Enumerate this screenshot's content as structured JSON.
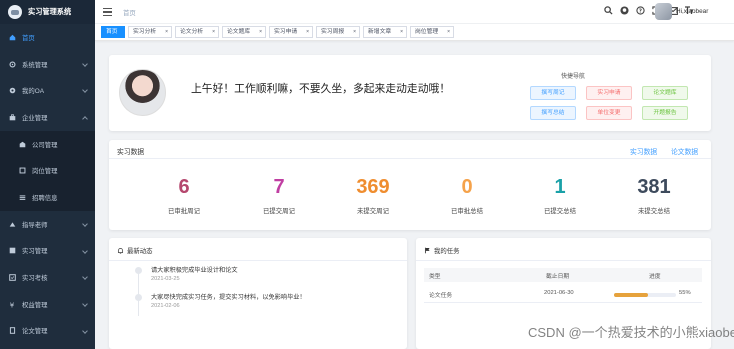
{
  "app": {
    "title": "实习管理系统"
  },
  "sidebar": {
    "items": [
      {
        "label": "首页",
        "icon": "home-icon"
      },
      {
        "label": "系统管理",
        "icon": "gear-icon"
      },
      {
        "label": "我的OA",
        "icon": "oa-icon"
      },
      {
        "label": "企业管理",
        "icon": "briefcase-icon"
      },
      {
        "label": "公司管理",
        "icon": "company-icon"
      },
      {
        "label": "岗位管理",
        "icon": "position-icon"
      },
      {
        "label": "招聘信息",
        "icon": "recruit-icon"
      },
      {
        "label": "指导老师",
        "icon": "teacher-icon"
      },
      {
        "label": "实习管理",
        "icon": "internship-icon"
      },
      {
        "label": "实习考核",
        "icon": "assessment-icon"
      },
      {
        "label": "权益管理",
        "icon": "rights-icon"
      },
      {
        "label": "论文管理",
        "icon": "paper-icon"
      }
    ]
  },
  "navbar": {
    "breadcrumb": "首页",
    "user_name": "Hi,xiaobear"
  },
  "tags": [
    {
      "label": "首页"
    },
    {
      "label": "实习分析"
    },
    {
      "label": "论文分析"
    },
    {
      "label": "论文题库"
    },
    {
      "label": "实习申请"
    },
    {
      "label": "实习周报"
    },
    {
      "label": "新增文章"
    },
    {
      "label": "岗位管理"
    }
  ],
  "welcome": {
    "greeting": "上午好！工作顺利嘛，不要久坐，多起来走动走动哦！"
  },
  "quick_nav": {
    "title": "快捷导航",
    "buttons": [
      {
        "label": "撰写周记"
      },
      {
        "label": "实习申请"
      },
      {
        "label": "论文题库"
      },
      {
        "label": "撰写总结"
      },
      {
        "label": "单位变更"
      },
      {
        "label": "开题报告"
      }
    ]
  },
  "stats": {
    "title": "实习数据",
    "links": [
      "实习数据",
      "论文数据"
    ],
    "items": [
      {
        "value": "6",
        "label": "已审批周记",
        "color": "#b5476e"
      },
      {
        "value": "7",
        "label": "已提交周记",
        "color": "#c03ea2"
      },
      {
        "value": "369",
        "label": "未提交周记",
        "color": "#ef8d2f"
      },
      {
        "value": "0",
        "label": "已审批总结",
        "color": "#f5a24a"
      },
      {
        "value": "1",
        "label": "已提交总结",
        "color": "#1aa1a8"
      },
      {
        "value": "381",
        "label": "未提交总结",
        "color": "#3d4a5c"
      }
    ]
  },
  "news": {
    "title": "最新动态",
    "items": [
      {
        "text": "请大家积极完成毕业设计和论文",
        "date": "2021-03-25"
      },
      {
        "text": "大家尽快完成实习任务，提交实习材料，以免影响毕业！",
        "date": "2021-02-06"
      }
    ]
  },
  "tasks": {
    "title": "我的任务",
    "headers": [
      "类型",
      "截止日期",
      "进度"
    ],
    "rows": [
      {
        "type": "论文任务",
        "deadline": "2021-06-30",
        "progress": 55,
        "progress_label": "55%"
      }
    ]
  },
  "watermark": "CSDN @一个热爱技术的小熊xiaobear"
}
